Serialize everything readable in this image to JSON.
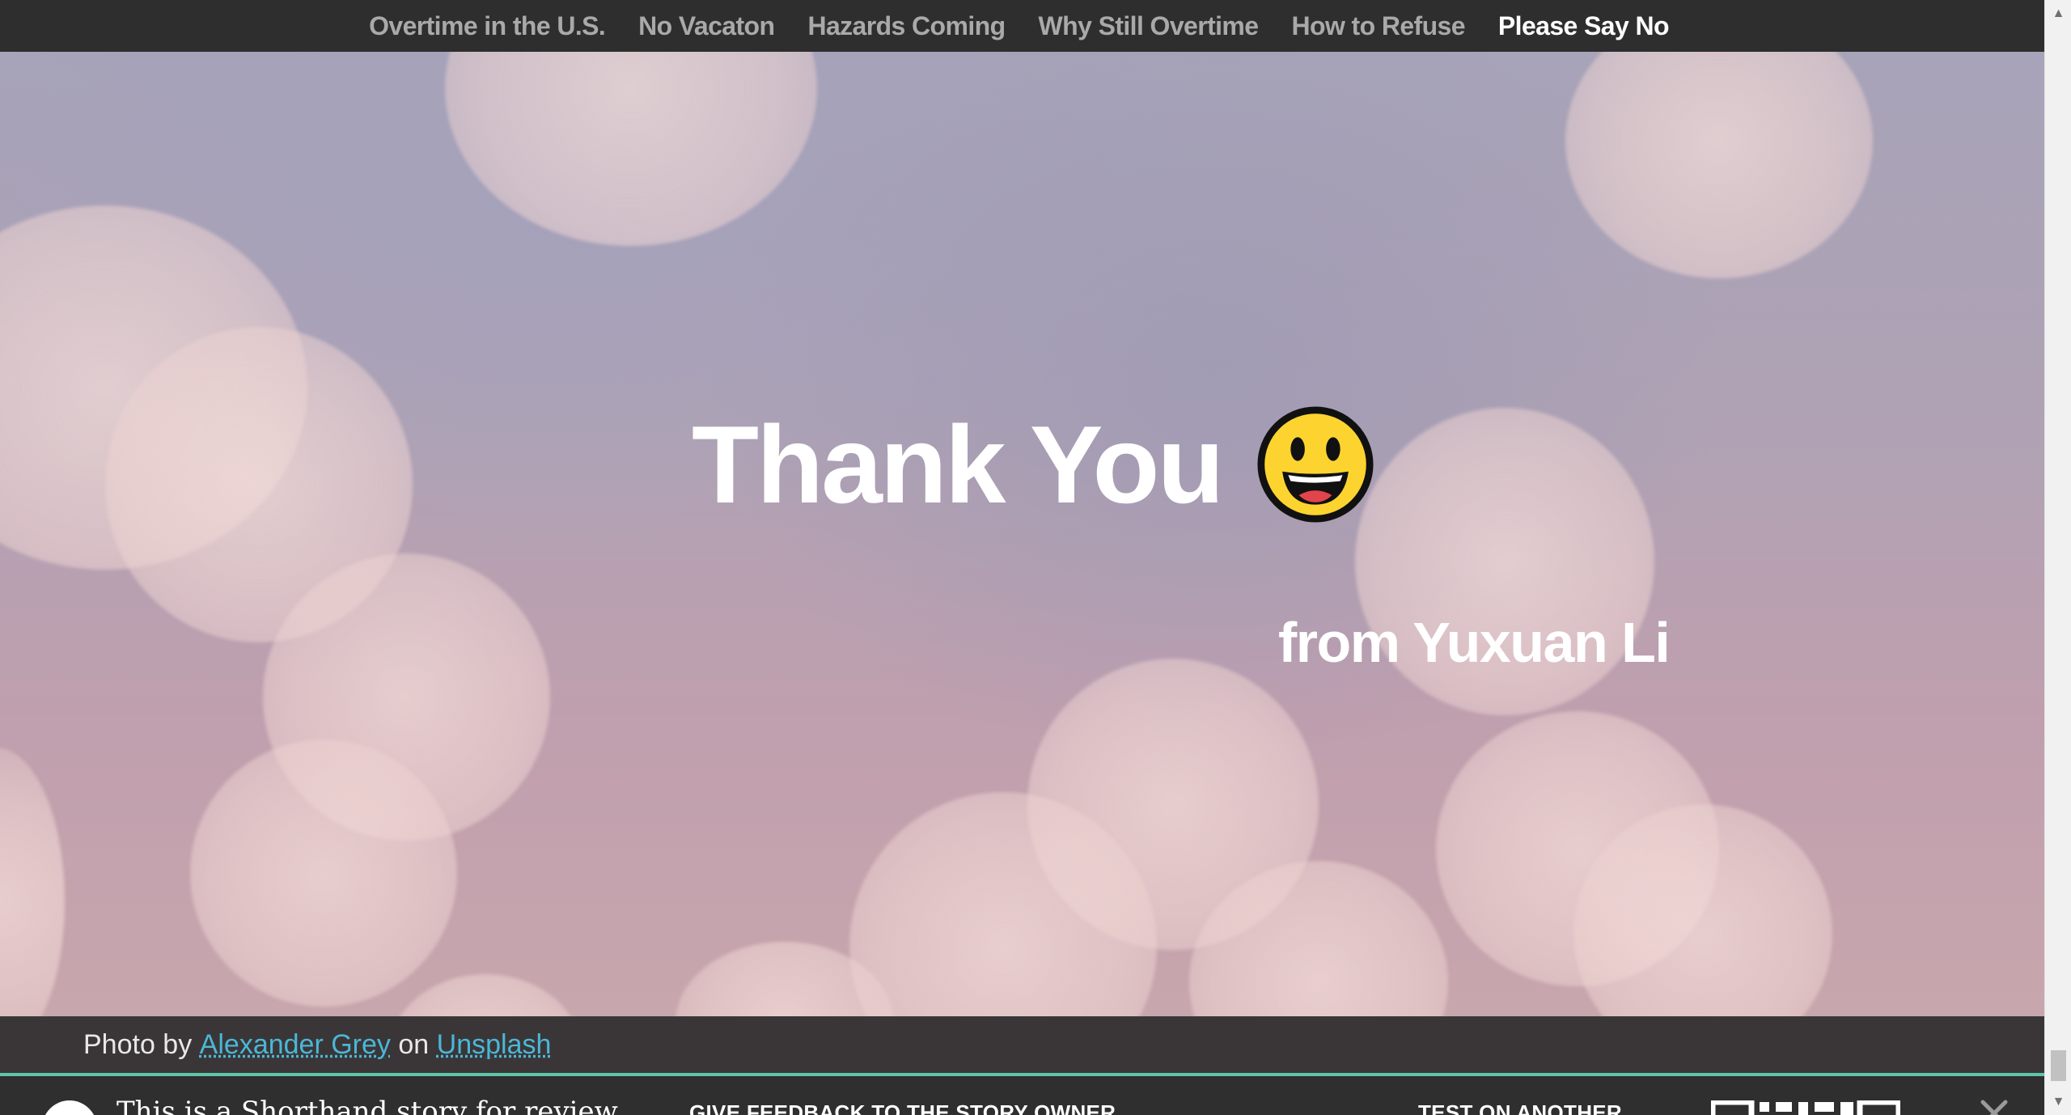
{
  "nav": {
    "items": [
      {
        "label": "Overtime in the U.S."
      },
      {
        "label": "No Vacaton"
      },
      {
        "label": "Hazards Coming"
      },
      {
        "label": "Why Still Overtime"
      },
      {
        "label": "How to Refuse"
      },
      {
        "label": "Please Say No"
      }
    ],
    "active_index": 5
  },
  "hero": {
    "title": "Thank You",
    "subtitle": "from Yuxuan Li",
    "emoji_icon": "grinning-face-icon"
  },
  "credit": {
    "prefix": "Photo by",
    "author": "Alexander Grey",
    "joiner": "on",
    "site": "Unsplash"
  },
  "review_bar": {
    "message": "This is a Shorthand story for review",
    "feedback_label": "GIVE FEEDBACK TO THE STORY OWNER",
    "test_label": "TEST ON ANOTHER",
    "qr_icon": "qr-code-icon",
    "close_icon": "close-icon"
  },
  "colors": {
    "nav_bg": "#2e2e2e",
    "nav_text": "#a9a9a9",
    "nav_active": "#ffffff",
    "link": "#4bb7d6",
    "review_accent": "#5ec6a9"
  }
}
